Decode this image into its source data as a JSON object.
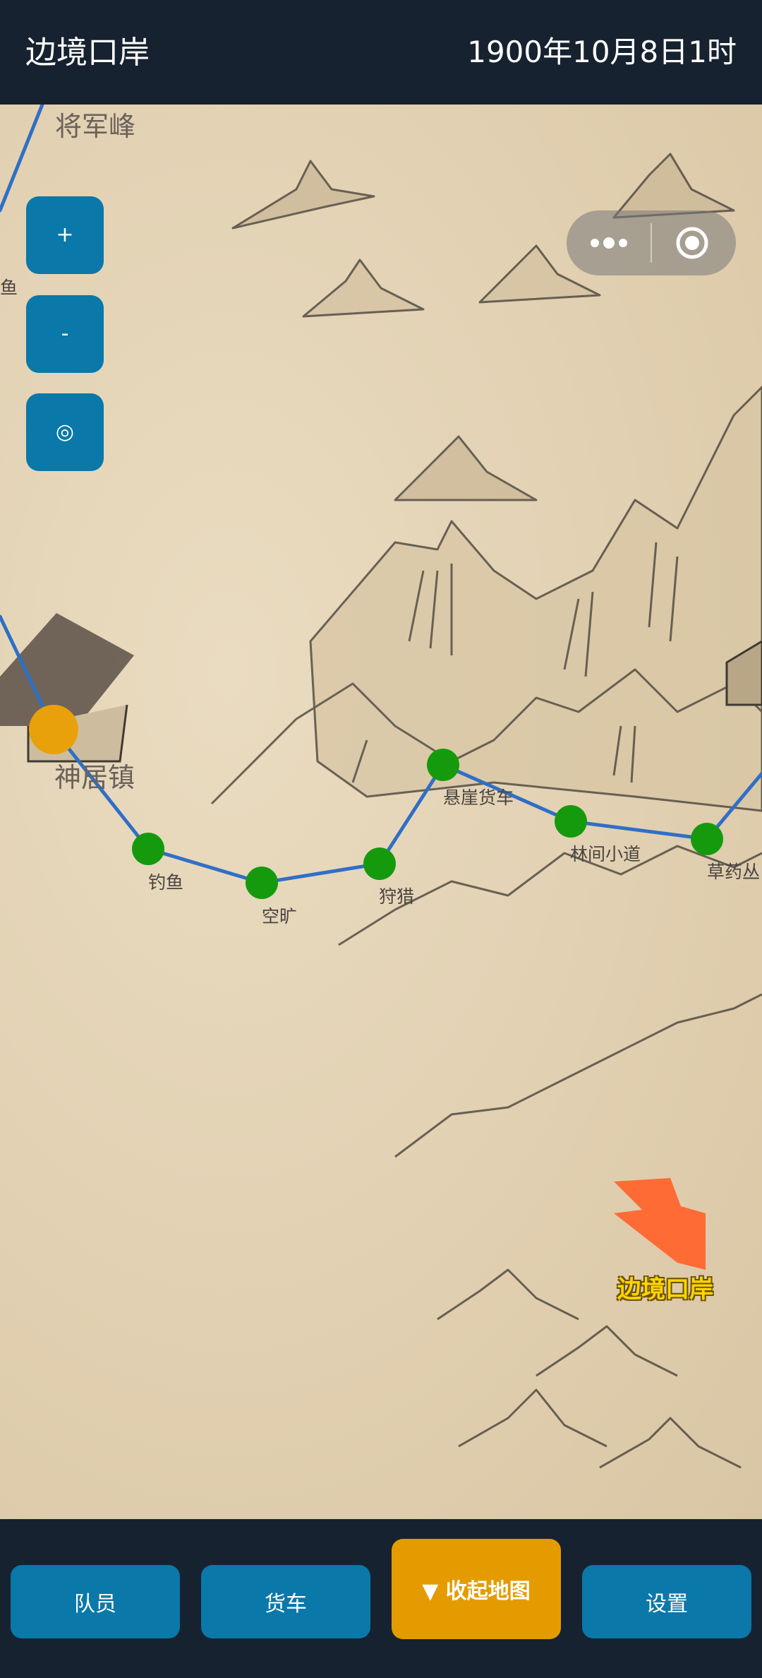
{
  "header": {
    "title": "边境口岸",
    "datetime": "1900年10月8日1时"
  },
  "map_controls": {
    "zoom_in": "+",
    "zoom_out": "-",
    "locate": "◎"
  },
  "map": {
    "peak_label": "将军峰",
    "edge_label": "鱼",
    "town_label": "神居镇",
    "nodes": {
      "fishing": "钓鱼",
      "empty": "空旷",
      "hunting": "狩猎",
      "cliff_cargo": "悬崖货车",
      "forest_path": "林间小道",
      "herb_bush": "草药丛"
    },
    "destination": "边境口岸",
    "colors": {
      "route": "#2f6fc6",
      "node": "#159a0e",
      "town_node": "#e8a10a",
      "arrow": "#ff6b35"
    }
  },
  "bottom_nav": {
    "members": "队员",
    "cargo": "货车",
    "collapse_map": "▼ 收起地图",
    "settings": "设置"
  }
}
